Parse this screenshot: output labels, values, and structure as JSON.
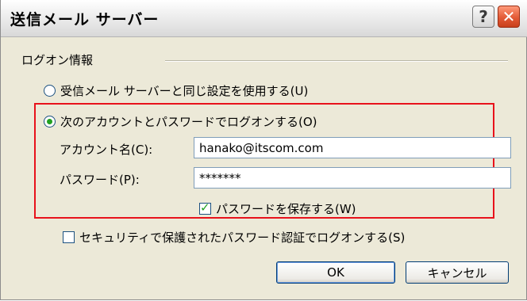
{
  "window": {
    "title": "送信メール サーバー",
    "help_label": "?",
    "close_label": "✕"
  },
  "group": {
    "label": "ログオン情報"
  },
  "options": {
    "same_settings_label": "受信メール サーバーと同じ設定を使用する(U)",
    "same_settings_selected": false,
    "use_account_label": "次のアカウントとパスワードでログオンする(O)",
    "use_account_selected": true
  },
  "account": {
    "label": "アカウント名(C):",
    "value": "hanako@itscom.com"
  },
  "password": {
    "label": "パスワード(P):",
    "value": "*******"
  },
  "save_password": {
    "label": "パスワードを保存する(W)",
    "checked": true
  },
  "spa": {
    "label": "セキュリティで保護されたパスワード認証でログオンする(S)",
    "checked": false
  },
  "buttons": {
    "ok": "OK",
    "cancel": "キャンセル"
  },
  "colors": {
    "highlight_border": "#e8121b",
    "radio_dot": "#21a121",
    "dialog_bg": "#ece9d8"
  }
}
